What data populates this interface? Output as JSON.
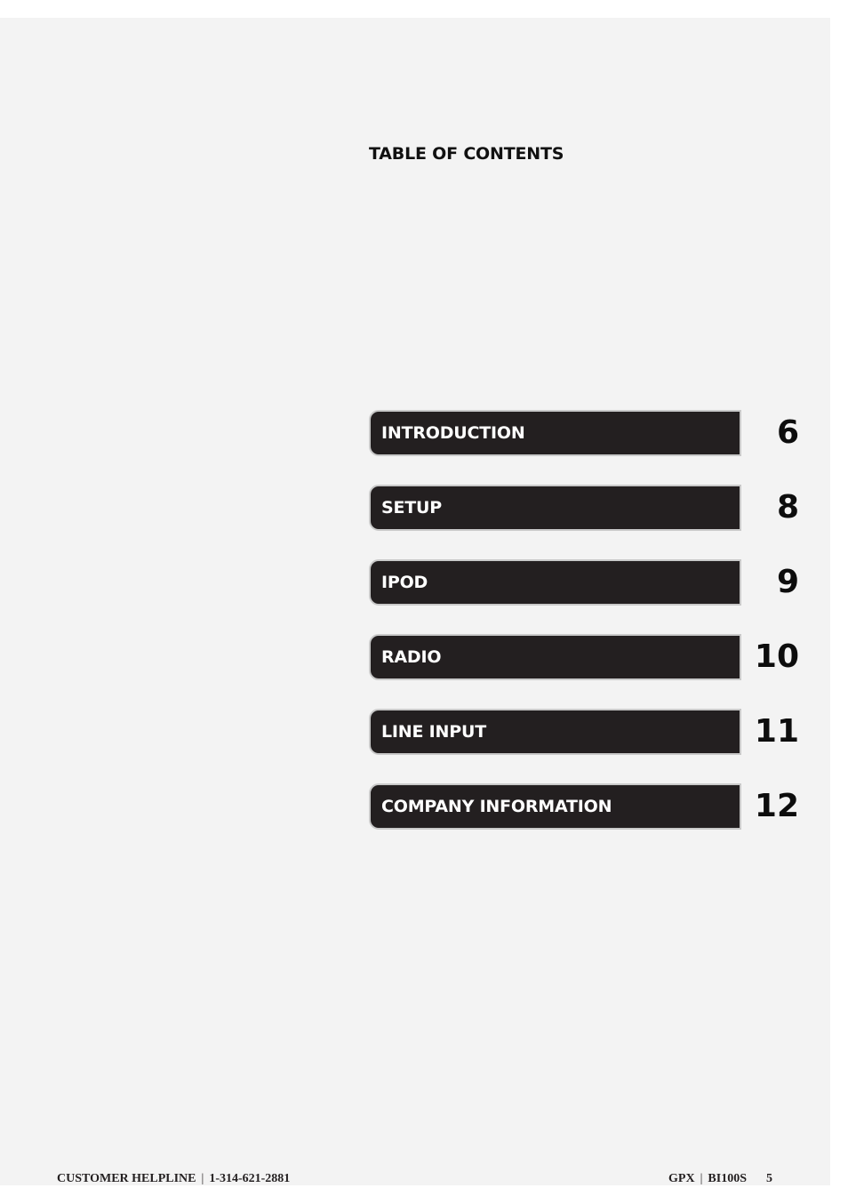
{
  "title": "TABLE OF CONTENTS",
  "toc": [
    {
      "label": "INTRODUCTION",
      "page": "6"
    },
    {
      "label": "SETUP",
      "page": "8"
    },
    {
      "label": "IPOD",
      "page": "9"
    },
    {
      "label": "RADIO",
      "page": "10"
    },
    {
      "label": "LINE INPUT",
      "page": "11"
    },
    {
      "label": "COMPANY INFORMATION",
      "page": "12"
    }
  ],
  "footer": {
    "helpline_label": "CUSTOMER HELPLINE",
    "helpline_number": "1-314-621-2881",
    "brand": "GPX",
    "model": "BI100S",
    "page_number": "5",
    "separator": "|"
  },
  "colors": {
    "page_background": "#f3f3f3",
    "bar_fill": "#231f20",
    "bar_border": "#c9c9c9",
    "bar_text": "#ffffff"
  }
}
